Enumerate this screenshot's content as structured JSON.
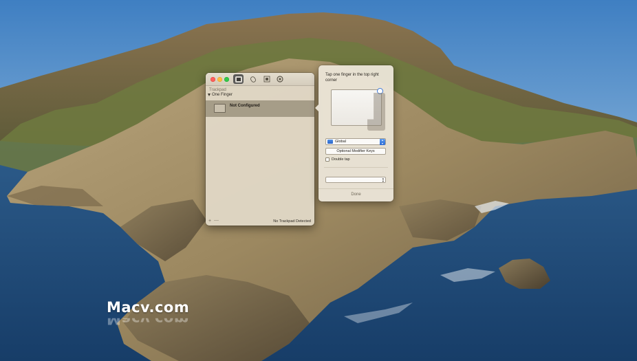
{
  "window": {
    "toolbar_tabs": [
      {
        "icon": "trackpad-icon",
        "active": true
      },
      {
        "icon": "mouse-icon",
        "active": false
      },
      {
        "icon": "keyboard-icon",
        "active": false
      },
      {
        "icon": "settings-gear-icon",
        "active": false
      }
    ],
    "sidebar": {
      "section": "Trackpad",
      "group": "One Finger",
      "items": [
        {
          "label": "Not Configured",
          "selected": true
        }
      ]
    },
    "bottombar": {
      "add": "+",
      "remove": "—",
      "status": "No Trackpad Detected"
    }
  },
  "popover": {
    "title": "Tap one finger in the top right corner",
    "scope": "Global",
    "modifier_button": "Optional Modifier Keys",
    "double_tap": {
      "label": "Double tap",
      "checked": false
    },
    "action": "",
    "done": "Done"
  },
  "colors": {
    "accent": "#3d78d8",
    "selection": "#a69d88",
    "close": "#fc605c",
    "minimize": "#fdbc40",
    "maximize": "#34c84a"
  },
  "watermark": {
    "text": "Macv.com"
  }
}
